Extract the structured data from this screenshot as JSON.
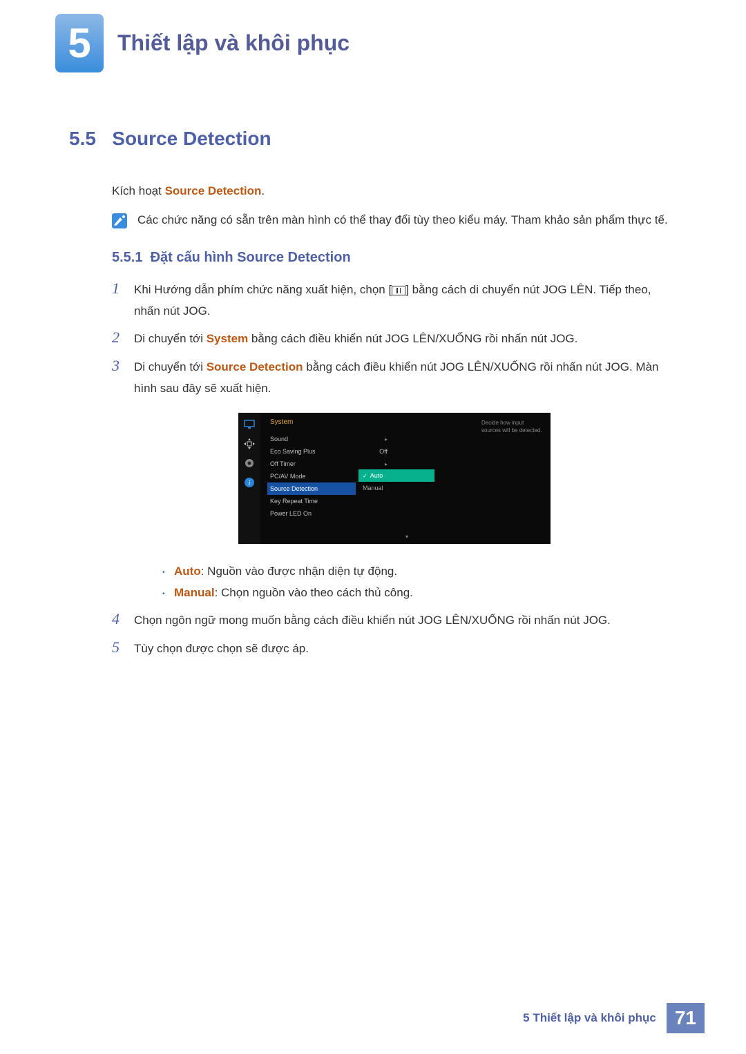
{
  "chapter": {
    "number": "5",
    "title": "Thiết lập và khôi phục"
  },
  "section": {
    "number": "5.5",
    "title": "Source Detection"
  },
  "intro": {
    "prefix": "Kích hoạt ",
    "keyword": "Source Detection",
    "suffix": "."
  },
  "note": "Các chức năng có sẵn trên màn hình có thể thay đổi tùy theo kiểu máy. Tham khảo sản phẩm thực tế.",
  "subsection": {
    "number": "5.5.1",
    "title": "Đặt cấu hình Source Detection"
  },
  "steps": {
    "s1": {
      "num": "1",
      "pre": "Khi Hướng dẫn phím chức năng xuất hiện, chọn [",
      "post": "] bằng cách di chuyển nút JOG LÊN. Tiếp theo, nhấn nút JOG."
    },
    "s2": {
      "num": "2",
      "pre": "Di chuyển tới ",
      "kw": "System",
      "post": " bằng cách điều khiển nút JOG LÊN/XUỐNG rồi nhấn nút JOG."
    },
    "s3": {
      "num": "3",
      "pre": "Di chuyển tới ",
      "kw": "Source Detection",
      "post": " bằng cách điều khiển nút JOG LÊN/XUỐNG rồi nhấn nút JOG. Màn hình sau đây sẽ xuất hiện."
    },
    "s4": {
      "num": "4",
      "text": "Chọn ngôn ngữ mong muốn bằng cách điều khiển nút JOG LÊN/XUỐNG rồi nhấn nút JOG."
    },
    "s5": {
      "num": "5",
      "text": "Tùy chọn được chọn sẽ được áp."
    }
  },
  "osd": {
    "menu_title": "System",
    "rows": {
      "sound": {
        "label": "Sound",
        "val": "▸"
      },
      "eco": {
        "label": "Eco Saving Plus",
        "val": "Off"
      },
      "timer": {
        "label": "Off Timer",
        "val": "▸"
      },
      "pcav": {
        "label": "PC/AV Mode",
        "val": ""
      },
      "src": {
        "label": "Source Detection",
        "val": ""
      },
      "key": {
        "label": "Key Repeat Time",
        "val": ""
      },
      "led": {
        "label": "Power LED On",
        "val": ""
      }
    },
    "submenu": {
      "auto": "Auto",
      "manual": "Manual"
    },
    "descr": "Decide how input sources will be detected."
  },
  "bullets": {
    "auto": {
      "kw": "Auto",
      "text": ": Nguồn vào được nhận diện tự động."
    },
    "manual": {
      "kw": "Manual",
      "text": ": Chọn nguồn vào theo cách thủ công."
    }
  },
  "footer": {
    "label": "5 Thiết lập và khôi phục",
    "page": "71"
  }
}
